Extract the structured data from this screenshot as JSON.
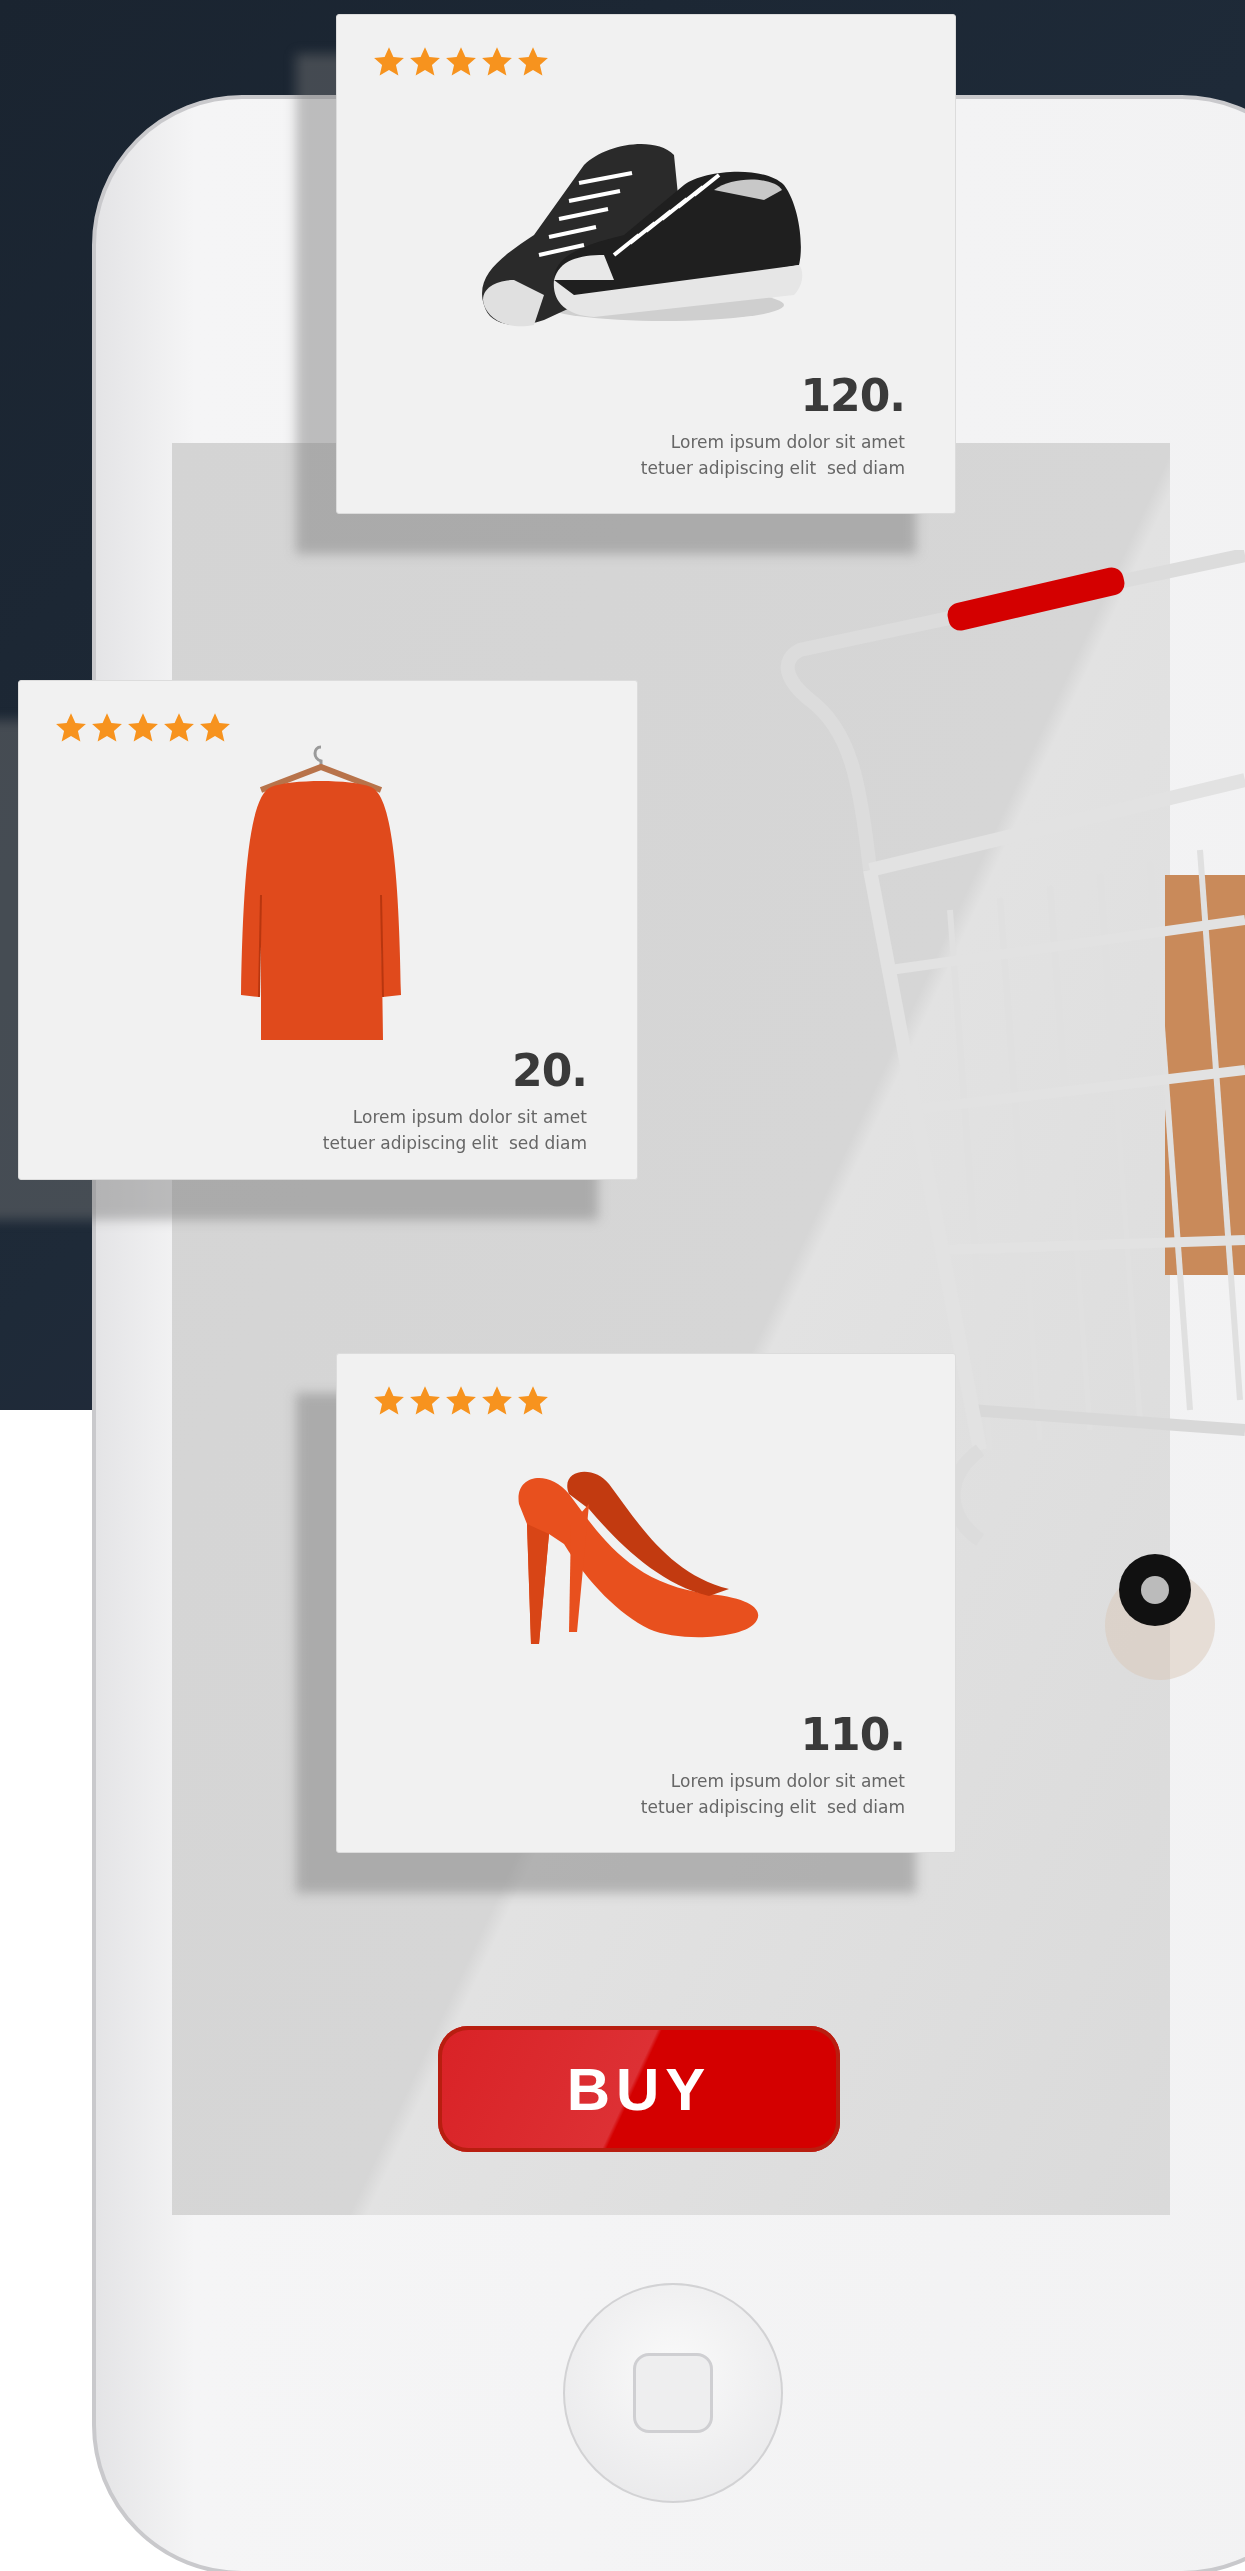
{
  "products": [
    {
      "kind": "sneakers",
      "stars": 5,
      "price": "120.",
      "description": "Lorem ipsum dolor sit amet\ntetuer adipiscing elit  sed diam"
    },
    {
      "kind": "dress",
      "stars": 5,
      "price": "20.",
      "description": "Lorem ipsum dolor sit amet\ntetuer adipiscing elit  sed diam"
    },
    {
      "kind": "heels",
      "stars": 5,
      "price": "110.",
      "description": "Lorem ipsum dolor sit amet\ntetuer adipiscing elit  sed diam"
    }
  ],
  "buy_button": {
    "label": "BUY"
  }
}
